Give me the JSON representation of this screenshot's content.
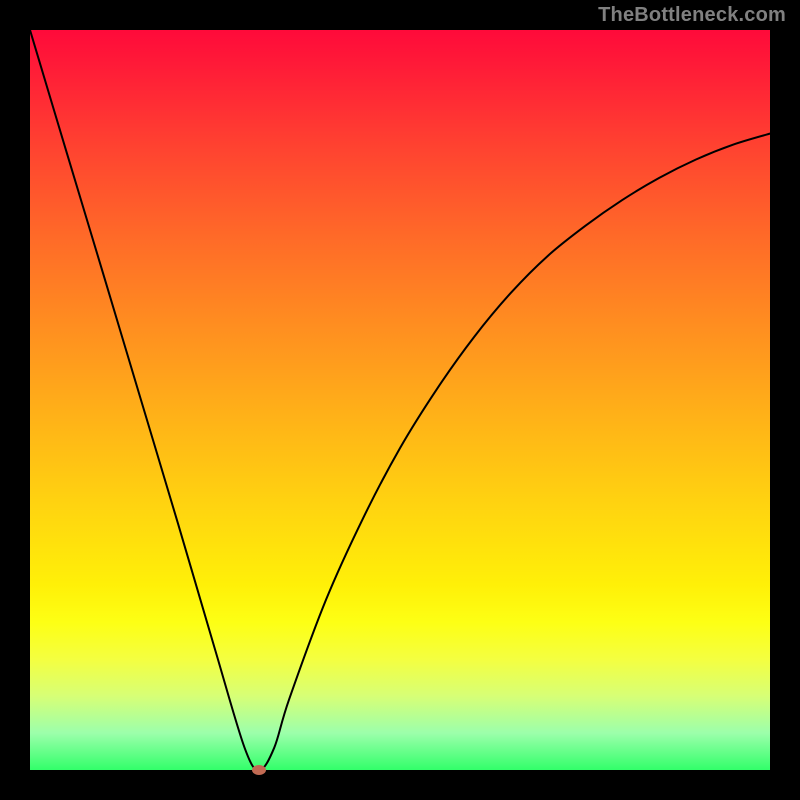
{
  "watermark": "TheBottleneck.com",
  "colors": {
    "background": "#000000",
    "gradient_top": "#ff0a3a",
    "gradient_bottom": "#32ff6a",
    "curve": "#000000",
    "marker": "#c16a53"
  },
  "chart_data": {
    "type": "line",
    "title": "",
    "xlabel": "",
    "ylabel": "",
    "xlim": [
      0,
      100
    ],
    "ylim": [
      0,
      100
    ],
    "grid": false,
    "legend": false,
    "series": [
      {
        "name": "curve",
        "x": [
          0,
          5,
          10,
          15,
          20,
          25,
          29,
          31,
          33,
          35,
          40,
          45,
          50,
          55,
          60,
          65,
          70,
          75,
          80,
          85,
          90,
          95,
          100
        ],
        "values": [
          100,
          83.3,
          66.7,
          50.0,
          33.3,
          16.3,
          3.0,
          0.0,
          3.0,
          9.5,
          23.0,
          34.0,
          43.5,
          51.5,
          58.5,
          64.5,
          69.5,
          73.5,
          77.0,
          80.0,
          82.5,
          84.5,
          86.0
        ]
      }
    ],
    "annotations": [
      {
        "name": "marker",
        "x": 31,
        "y": 0,
        "shape": "ellipse",
        "color": "#c16a53"
      }
    ]
  }
}
